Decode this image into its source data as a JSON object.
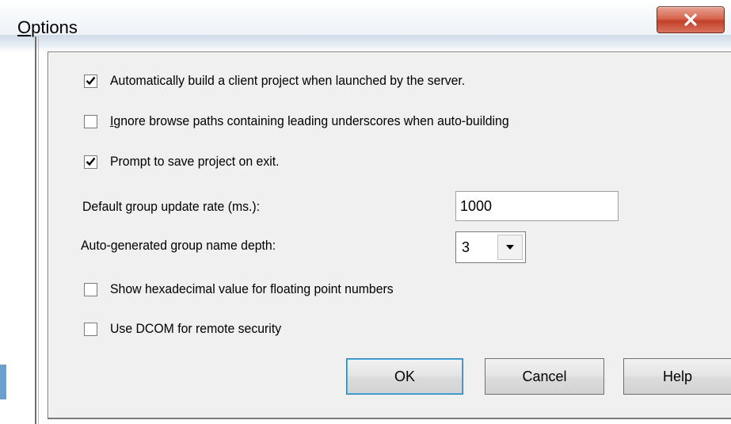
{
  "window": {
    "title_prefix": "O",
    "title_rest": "ptions",
    "close_icon": "close-x-icon"
  },
  "options": {
    "auto_build": {
      "label": "Automatically build a client project when launched by the server.",
      "checked": true
    },
    "ignore_underscores": {
      "label_before": "",
      "mnemonic": "I",
      "label_after": "gnore browse paths containing leading underscores when auto-building",
      "checked": false
    },
    "prompt_save": {
      "label": "Prompt to save project on exit.",
      "checked": true
    },
    "update_rate": {
      "label": "Default group update rate (ms.):",
      "value": "1000"
    },
    "name_depth": {
      "label": "Auto-generated group name depth:",
      "value": "3"
    },
    "show_hex": {
      "label": "Show hexadecimal value for floating point numbers",
      "checked": false
    },
    "use_dcom": {
      "label": "Use DCOM for remote security",
      "checked": false
    }
  },
  "buttons": {
    "ok": "OK",
    "cancel": "Cancel",
    "help": "Help"
  }
}
